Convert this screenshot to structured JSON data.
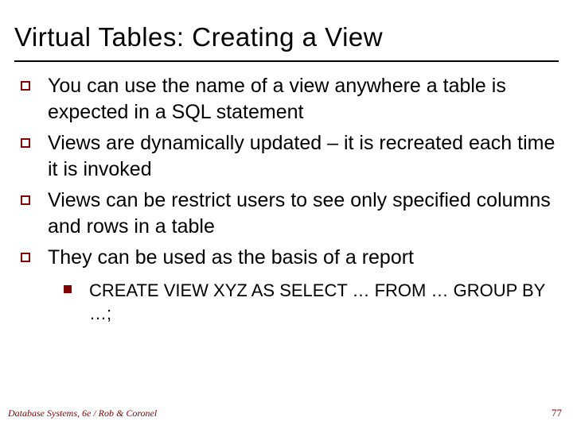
{
  "title": "Virtual Tables: Creating a View",
  "bullets": [
    "You can use the name of a view anywhere a table is expected in a SQL statement",
    "Views are dynamically updated – it is recreated each time it is invoked",
    "Views can be restrict users to see only specified columns and rows in a table",
    "They can be used as the basis of a report"
  ],
  "sub_bullets": [
    "CREATE VIEW XYZ AS SELECT … FROM … GROUP BY …;"
  ],
  "footer": {
    "source": "Database Systems, 6e / Rob & Coronel",
    "page": "77"
  },
  "colors": {
    "accent": "#800000",
    "text": "#000000",
    "background": "#ffffff"
  }
}
